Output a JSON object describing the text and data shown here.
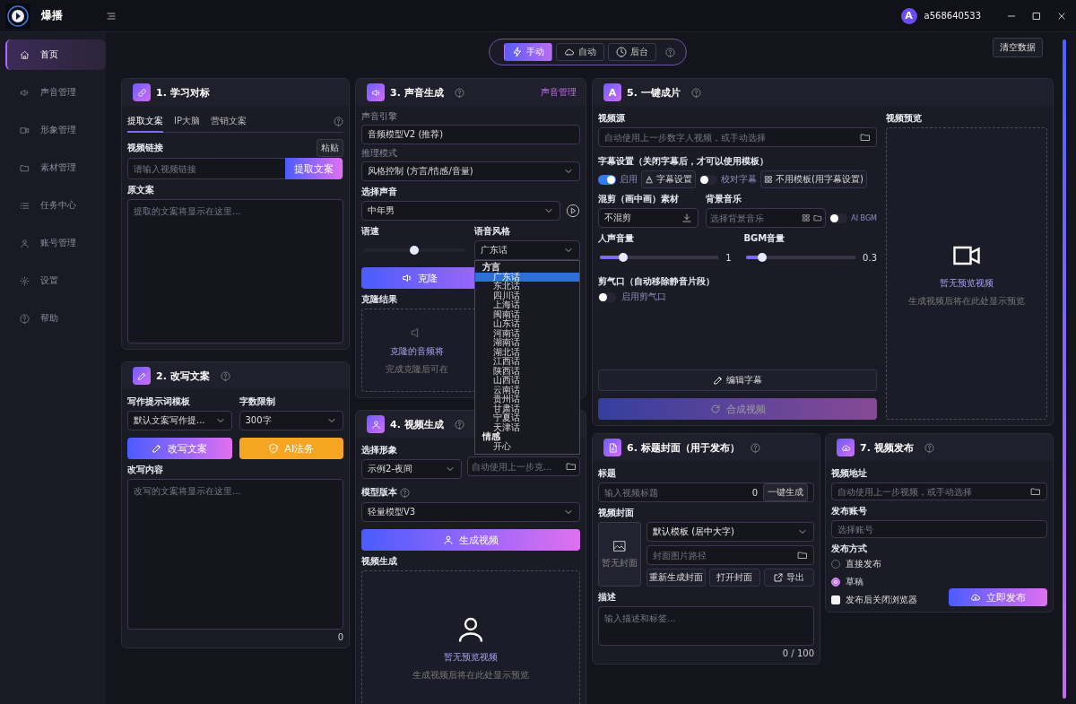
{
  "app": {
    "name": "爆播"
  },
  "account": {
    "avatar": "A",
    "name": "a568640533"
  },
  "sidebar": {
    "items": [
      {
        "label": "首页",
        "selected": true
      },
      {
        "label": "声音管理",
        "selected": false
      },
      {
        "label": "形象管理",
        "selected": false
      },
      {
        "label": "素材管理",
        "selected": false
      },
      {
        "label": "任务中心",
        "selected": false
      },
      {
        "label": "账号管理",
        "selected": false
      },
      {
        "label": "设置",
        "selected": false
      },
      {
        "label": "帮助",
        "selected": false
      }
    ]
  },
  "modes": [
    {
      "label": "手动",
      "selected": true
    },
    {
      "label": "自动",
      "selected": false
    },
    {
      "label": "后台",
      "selected": false
    }
  ],
  "clear_button": "清空数据",
  "panel_learn": {
    "title": "1. 学习对标",
    "tabs": [
      {
        "label": "提取文案",
        "selected": true
      },
      {
        "label": "IP大脑",
        "selected": false
      },
      {
        "label": "营销文案",
        "selected": false
      }
    ],
    "link_label": "视频链接",
    "paste_button": "粘贴",
    "link_placeholder": "请输入视频链接",
    "extract_button": "提取文案",
    "source_label": "原文案",
    "source_placeholder": "提取的文案将显示在这里..."
  },
  "panel_rewrite": {
    "title": "2. 改写文案",
    "template_label": "写作提示词模板",
    "template_value": "默认文案写作提...",
    "limit_label": "字数限制",
    "limit_value": "300字",
    "rewrite_button": "改写文案",
    "legal_button": "AI法务",
    "content_label": "改写内容",
    "content_placeholder": "改写的文案将显示在这里...",
    "count": "0"
  },
  "panel_voice": {
    "title": "3. 声音生成",
    "manage_link": "声音管理",
    "engine_label": "声音引擎",
    "engine_value": "音频模型V2 (推荐)",
    "mode_label": "推理模式",
    "mode_value": "风格控制 (方言/情感/音量)",
    "voice_label": "选择声音",
    "voice_value": "中年男",
    "speed_label": "语速",
    "speed": {
      "level": 0.5
    },
    "style_label": "语音风格",
    "style_value": "广东话",
    "clone_button": "克隆",
    "result_label": "克隆结果",
    "result_text": "克隆的音频将",
    "result_hint": "完成克隆后可在"
  },
  "style_dropdown": {
    "groups": [
      {
        "label": "方言",
        "options": [
          {
            "label": "广东话",
            "selected": true
          },
          {
            "label": "东北话",
            "selected": false
          },
          {
            "label": "四川话",
            "selected": false
          },
          {
            "label": "上海话",
            "selected": false
          },
          {
            "label": "闽南话",
            "selected": false
          },
          {
            "label": "山东话",
            "selected": false
          },
          {
            "label": "河南话",
            "selected": false
          },
          {
            "label": "湖南话",
            "selected": false
          },
          {
            "label": "湖北话",
            "selected": false
          },
          {
            "label": "江西话",
            "selected": false
          },
          {
            "label": "陕西话",
            "selected": false
          },
          {
            "label": "山西话",
            "selected": false
          },
          {
            "label": "云南话",
            "selected": false
          },
          {
            "label": "贵州话",
            "selected": false
          },
          {
            "label": "甘肃话",
            "selected": false
          },
          {
            "label": "宁夏话",
            "selected": false
          },
          {
            "label": "天津话",
            "selected": false
          }
        ]
      },
      {
        "label": "情感",
        "options": [
          {
            "label": "开心",
            "selected": false
          }
        ]
      }
    ]
  },
  "panel_video": {
    "title": "4. 视频生成",
    "avatar_label": "选择形象",
    "avatar_value": "示例2-夜间",
    "audio_placeholder": "自动使用上一步克...",
    "model_label": "模型版本",
    "model_value": "轻量模型V3",
    "generate_button": "生成视频",
    "output_label": "视频生成",
    "empty_title": "暂无预览视频",
    "empty_hint": "生成视频后将在此处显示预览"
  },
  "panel_oneclick": {
    "title": "5. 一键成片",
    "icon_text": "A",
    "source_label": "视频源",
    "source_placeholder": "自动使用上一步数字人视频，或手动选择",
    "subtitle_label": "字幕设置（关闭字幕后，才可以使用模板）",
    "subtitle_toggle": {
      "label": "启用",
      "on": true
    },
    "subtitle_settings_button": "字幕设置",
    "proofread": {
      "label": "校对字幕",
      "on": false
    },
    "template_button": "不用模板(用字幕设置)",
    "mix_label": "混剪（画中画）素材",
    "mix_value": "不混剪",
    "bgm_label": "背景音乐",
    "bgm_placeholder": "选择背景音乐",
    "ai_bgm": {
      "label": "AI BGM",
      "on": false
    },
    "voice_volume_label": "人声音量",
    "voice_volume": {
      "level": 0.2,
      "reading": "1"
    },
    "bgm_volume_label": "BGM音量",
    "bgm_volume": {
      "level": 0.15,
      "reading": "0.3"
    },
    "breath_label": "剪气口（自动移除静音片段）",
    "breath_toggle": {
      "label": "启用剪气口",
      "on": false
    },
    "edit_button": "编辑字幕",
    "compose_button": {
      "label": "合成视频",
      "disabled": true
    },
    "preview_label": "视频预览",
    "preview_title": "暂无预览视频",
    "preview_hint": "生成视频后将在此处显示预览"
  },
  "panel_cover": {
    "title": "6. 标题封面（用于发布）",
    "title_label": "标题",
    "title_placeholder": "输入视频标题",
    "title_count": "0",
    "generate_button": "一键生成",
    "cover_label": "视频封面",
    "cover_empty": "暂无封面",
    "template_value": "默认模板 (居中大字)",
    "path_placeholder": "封面图片路径",
    "regen_button": "重新生成封面",
    "open_button": "打开封面",
    "export_button": "导出",
    "desc_label": "描述",
    "desc_placeholder": "输入描述和标签...",
    "desc_count": "0 / 100"
  },
  "panel_publish": {
    "title": "7. 视频发布",
    "address_label": "视频地址",
    "address_placeholder": "自动使用上一步视频，或手动选择",
    "account_label": "发布账号",
    "account_placeholder": "选择账号",
    "method_label": "发布方式",
    "methods": [
      {
        "label": "直接发布",
        "selected": false
      },
      {
        "label": "草稿",
        "selected": true
      }
    ],
    "close_browser": {
      "label": "发布后关闭浏览器",
      "checked": false
    },
    "publish_button": "立即发布"
  }
}
